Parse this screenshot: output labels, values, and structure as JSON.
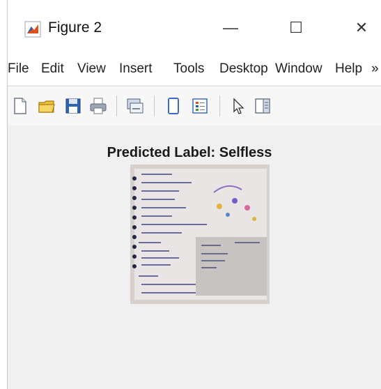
{
  "window": {
    "title": "Figure 2",
    "controls": {
      "minimize": "—",
      "maximize": "☐",
      "close": "✕"
    }
  },
  "menu": [
    "File",
    "Edit",
    "View",
    "Insert",
    "Tools",
    "Desktop",
    "Window",
    "Help"
  ],
  "menu_overflow": "»",
  "toolbar": {
    "buttons": [
      "new-figure-icon",
      "open-file-icon",
      "save-icon",
      "print-icon",
      "link-plot-icon",
      "open-property-inspector-icon",
      "insert-legend-icon",
      "pointer-icon",
      "show-plot-tools-icon"
    ]
  },
  "figure": {
    "title": "Predicted Label: Selfless"
  },
  "colors": {
    "window_bg": "#f0f0f0",
    "titlebar_bg": "#ffffff",
    "accent_orange": "#e0521c",
    "accent_blue": "#2b5fb3"
  }
}
